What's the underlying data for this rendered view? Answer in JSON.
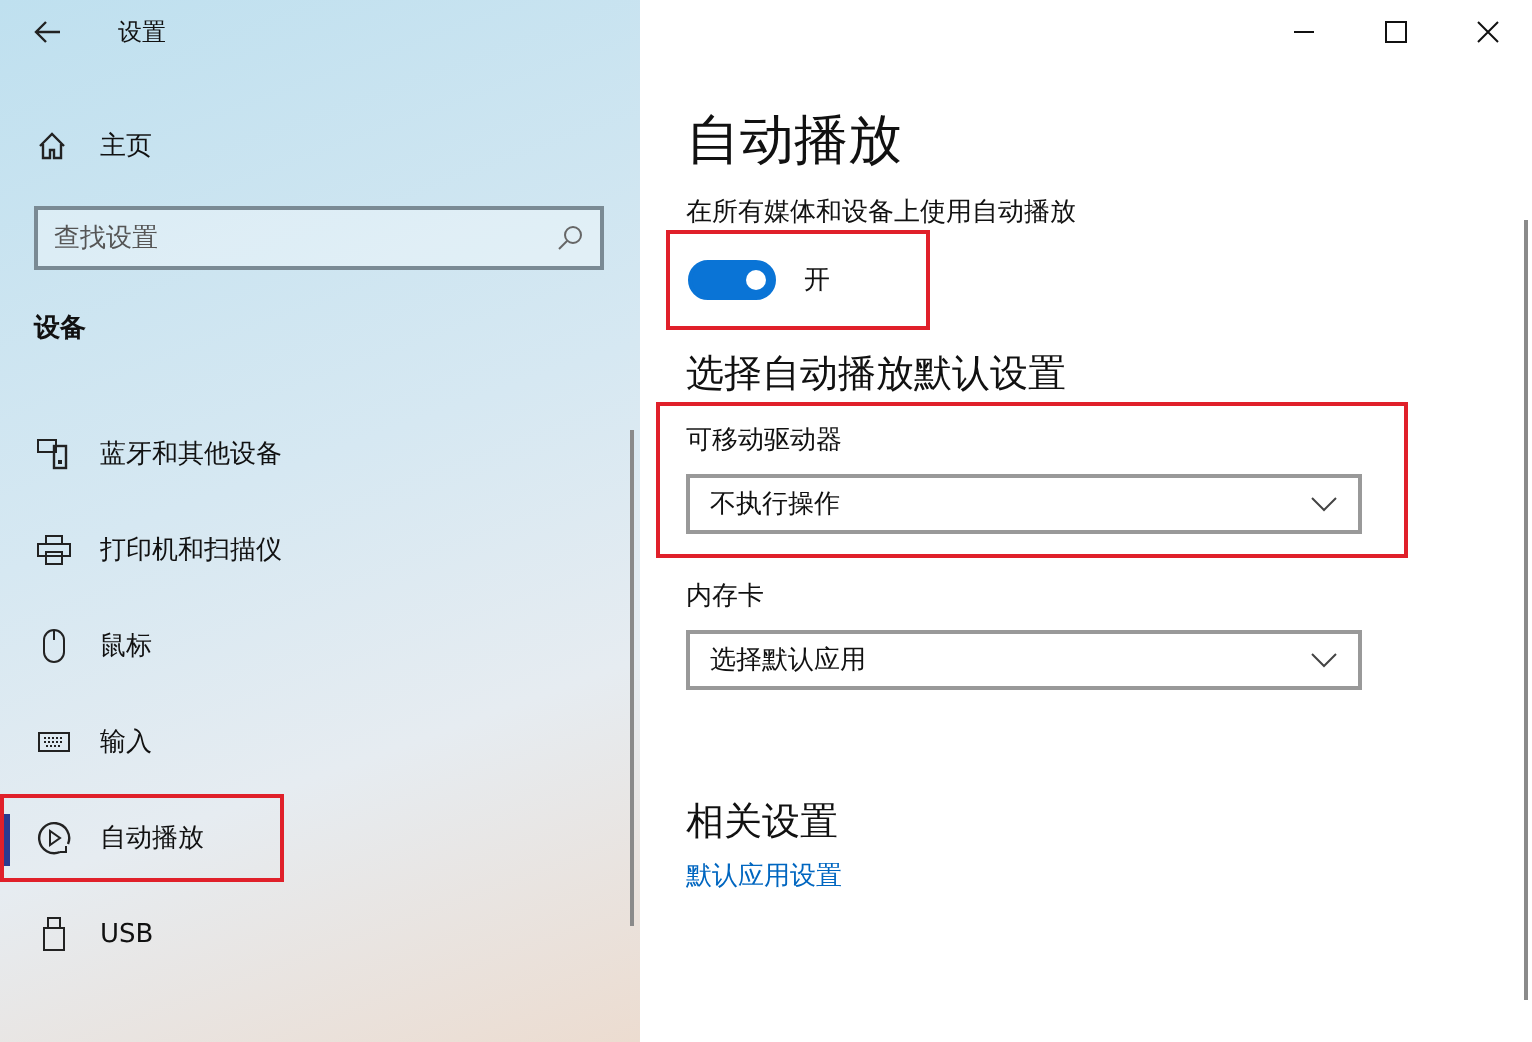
{
  "window": {
    "title": "设置"
  },
  "sidebar": {
    "home": "主页",
    "search": {
      "placeholder": "查找设置"
    },
    "section": "设备",
    "items": [
      {
        "label": "蓝牙和其他设备",
        "selected": false,
        "highlighted": false
      },
      {
        "label": "打印机和扫描仪",
        "selected": false,
        "highlighted": false
      },
      {
        "label": "鼠标",
        "selected": false,
        "highlighted": false
      },
      {
        "label": "输入",
        "selected": false,
        "highlighted": false
      },
      {
        "label": "自动播放",
        "selected": true,
        "highlighted": true
      },
      {
        "label": "USB",
        "selected": false,
        "highlighted": false
      }
    ]
  },
  "page": {
    "title": "自动播放",
    "toggle": {
      "label": "在所有媒体和设备上使用自动播放",
      "on": true,
      "state_text": "开",
      "highlighted": true
    },
    "defaults_heading": "选择自动播放默认设置",
    "dropdowns": [
      {
        "label": "可移动驱动器",
        "value": "不执行操作",
        "highlighted": true
      },
      {
        "label": "内存卡",
        "value": "选择默认应用",
        "highlighted": false
      }
    ],
    "related_heading": "相关设置",
    "related_link": "默认应用设置"
  }
}
